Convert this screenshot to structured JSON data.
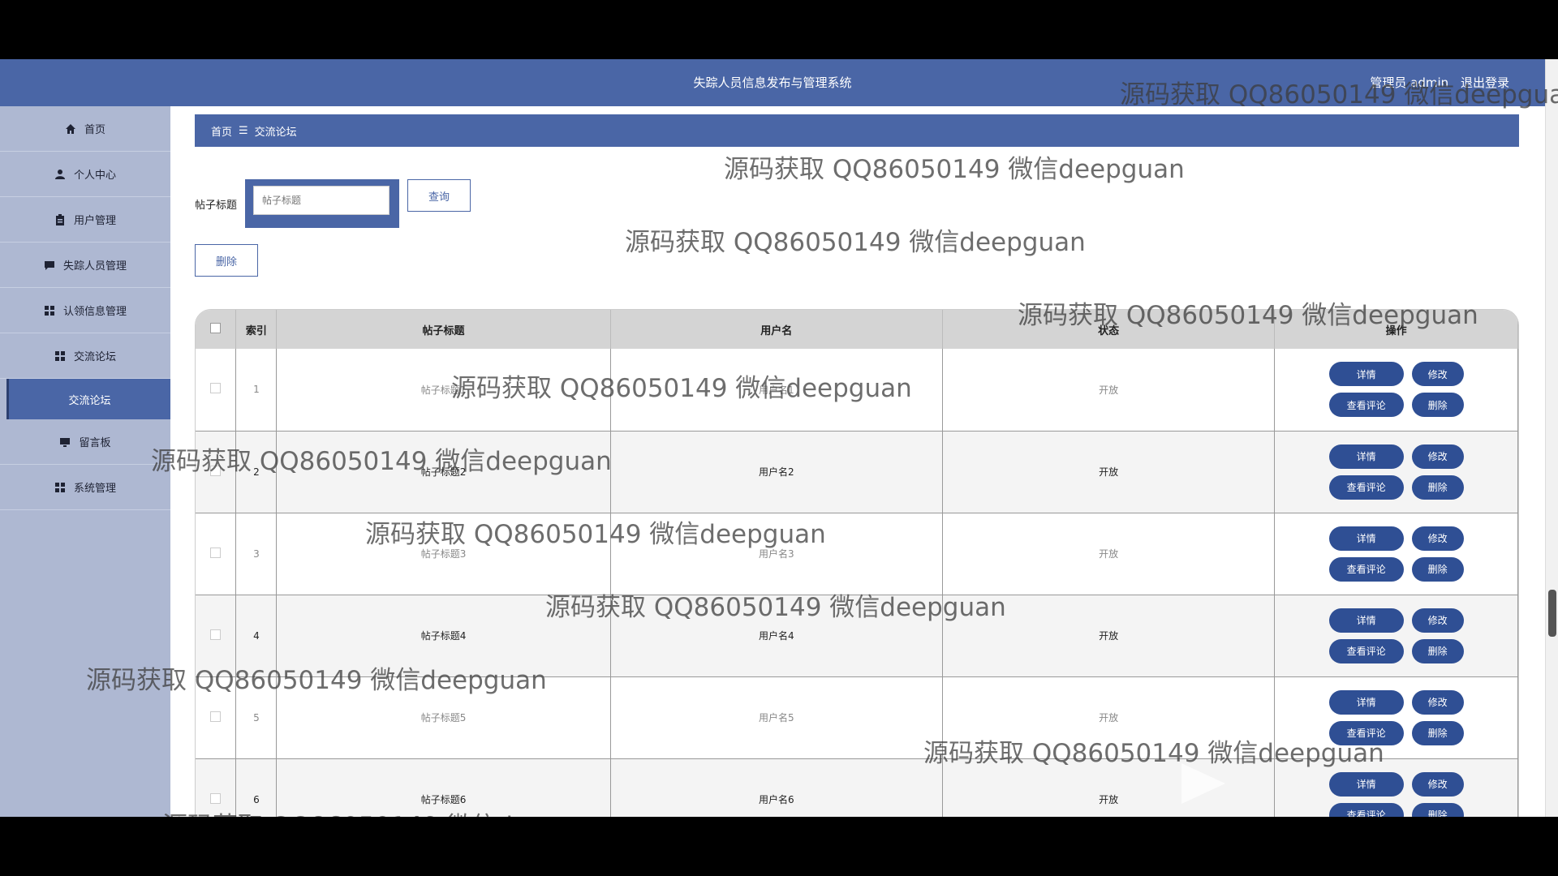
{
  "header": {
    "title": "失踪人员信息发布与管理系统",
    "user_label": "管理员 admin",
    "logout": "退出登录"
  },
  "sidebar": {
    "items": [
      {
        "label": "首页",
        "icon": "home-icon"
      },
      {
        "label": "个人中心",
        "icon": "user-icon"
      },
      {
        "label": "用户管理",
        "icon": "clipboard-icon"
      },
      {
        "label": "失踪人员管理",
        "icon": "chat-icon"
      },
      {
        "label": "认领信息管理",
        "icon": "grid-icon"
      },
      {
        "label": "交流论坛",
        "icon": "grid-icon"
      }
    ],
    "active_sub": "交流论坛",
    "items2": [
      {
        "label": "留言板",
        "icon": "monitor-icon"
      },
      {
        "label": "系统管理",
        "icon": "grid-icon"
      }
    ]
  },
  "breadcrumb": {
    "home": "首页",
    "sep": "☰",
    "current": "交流论坛"
  },
  "search": {
    "label": "帖子标题",
    "placeholder": "帖子标题",
    "button": "查询"
  },
  "actions": {
    "delete": "删除"
  },
  "table": {
    "headers": [
      "索引",
      "帖子标题",
      "用户名",
      "状态",
      "操作"
    ],
    "rows": [
      {
        "index": "1",
        "title": "帖子标题1",
        "username": "用户名1",
        "status": "开放"
      },
      {
        "index": "2",
        "title": "帖子标题2",
        "username": "用户名2",
        "status": "开放"
      },
      {
        "index": "3",
        "title": "帖子标题3",
        "username": "用户名3",
        "status": "开放"
      },
      {
        "index": "4",
        "title": "帖子标题4",
        "username": "用户名4",
        "status": "开放"
      },
      {
        "index": "5",
        "title": "帖子标题5",
        "username": "用户名5",
        "status": "开放"
      },
      {
        "index": "6",
        "title": "帖子标题6",
        "username": "用户名6",
        "status": "开放"
      }
    ],
    "row_buttons": {
      "detail": "详情",
      "edit": "修改",
      "comments": "查看评论",
      "delete": "删除"
    }
  },
  "watermark": "源码获取 QQ86050149 微信deepguan"
}
